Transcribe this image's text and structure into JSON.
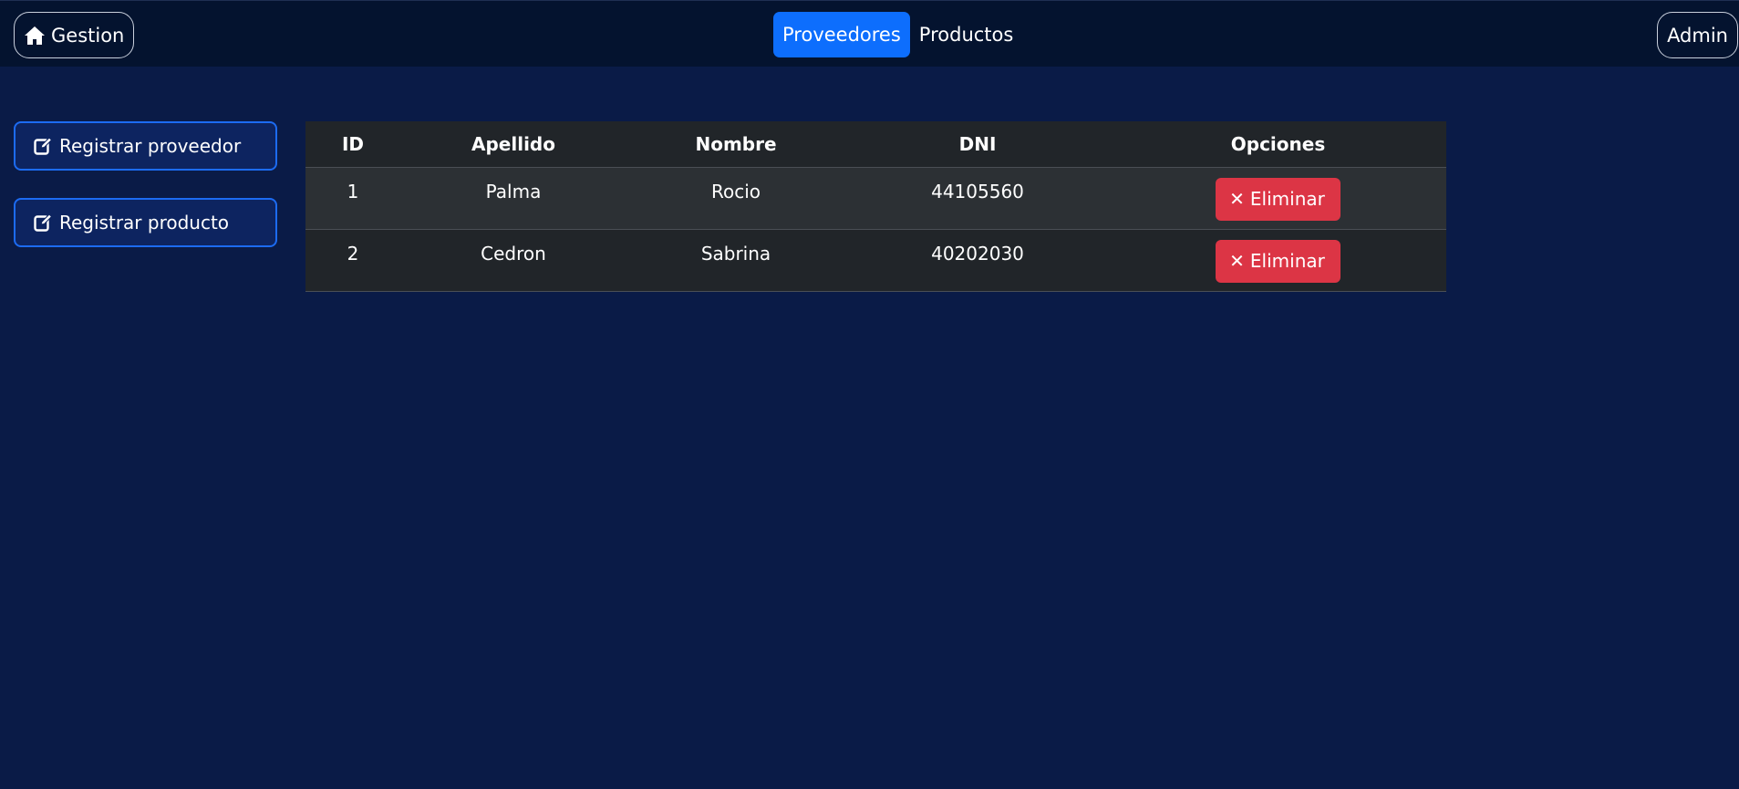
{
  "navbar": {
    "brand_label": "Gestion",
    "brand_icon": "home-icon",
    "links": [
      {
        "label": "Proveedores",
        "active": true
      },
      {
        "label": "Productos",
        "active": false
      }
    ],
    "user_label": "Admin"
  },
  "sidebar": {
    "register_supplier_label": "Registrar proveedor",
    "register_product_label": "Registrar producto",
    "icon": "edit-icon"
  },
  "table": {
    "columns": [
      "ID",
      "Apellido",
      "Nombre",
      "DNI",
      "Opciones"
    ],
    "rows": [
      {
        "id": "1",
        "apellido": "Palma",
        "nombre": "Rocio",
        "dni": "44105560",
        "action": "Eliminar"
      },
      {
        "id": "2",
        "apellido": "Cedron",
        "nombre": "Sabrina",
        "dni": "40202030",
        "action": "Eliminar"
      }
    ]
  },
  "colors": {
    "background": "#0a1b47",
    "navbar": "#04132f",
    "primary": "#0d6efd",
    "danger": "#dc3545",
    "table_dark": "#212529"
  }
}
